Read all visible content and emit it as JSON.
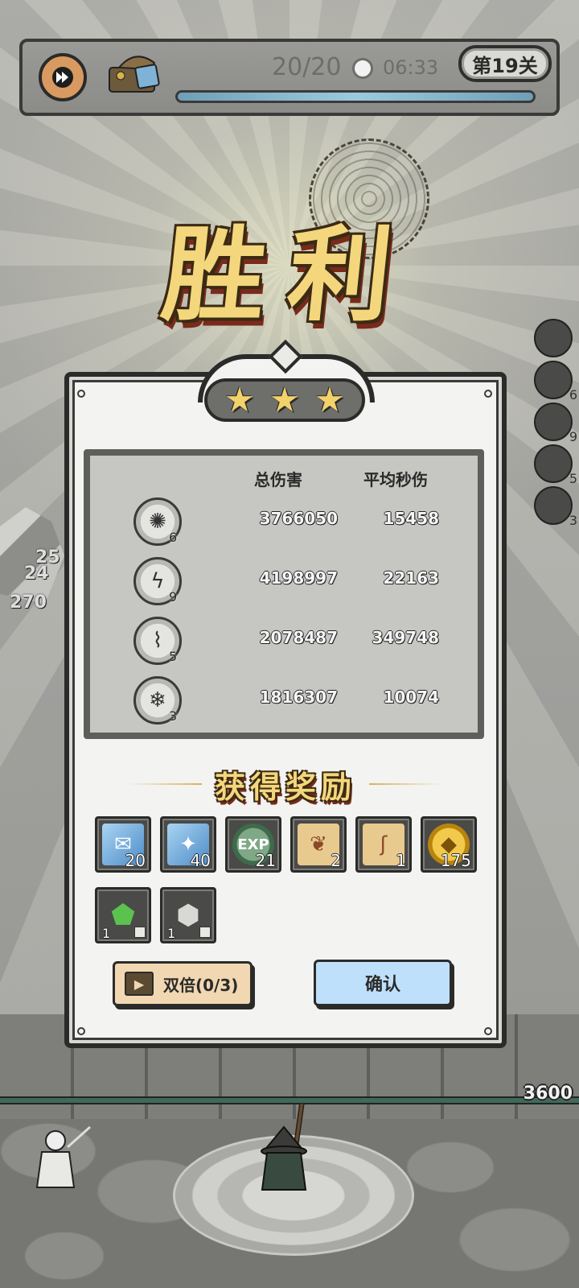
{
  "hud": {
    "wave": "20/20",
    "time": "06:33",
    "level": "第19关",
    "icons": {
      "speed": "fast-forward-icon",
      "chest": "treasure-chest-icon",
      "clock": "clock-icon"
    }
  },
  "victory": {
    "title": "胜利",
    "stars": 3
  },
  "side_heroes": [
    "",
    "6",
    "9",
    "5",
    "3"
  ],
  "battlefield": {
    "base_hp": "3600",
    "floating_damage": [
      "25",
      "24",
      "270"
    ]
  },
  "stats": {
    "headers": {
      "total": "总伤害",
      "avg": "平均秒伤"
    },
    "rows": [
      {
        "icon": "dark-vortex-hero-icon",
        "level": "6",
        "total": "3766050",
        "avg": "15458"
      },
      {
        "icon": "lightning-hero-icon",
        "level": "9",
        "total": "4198997",
        "avg": "22163"
      },
      {
        "icon": "cracked-earth-hero-icon",
        "level": "5",
        "total": "2078487",
        "avg": "349748"
      },
      {
        "icon": "ice-crystal-hero-icon",
        "level": "3",
        "total": "1816307",
        "avg": "10074"
      }
    ]
  },
  "rewards": {
    "title": "获得奖励",
    "items": [
      {
        "icon": "blue-paper-crystal-icon",
        "count": "20",
        "color": "#5f9fd8"
      },
      {
        "icon": "blue-shard-crystal-icon",
        "count": "40",
        "color": "#5f9fd8"
      },
      {
        "icon": "exp-orb-icon",
        "label": "EXP",
        "count": "21",
        "color": "#3e6b4a"
      },
      {
        "icon": "meat-scroll-icon",
        "count": "2",
        "color": "#e8c98e"
      },
      {
        "icon": "hook-scroll-icon",
        "count": "1",
        "color": "#e8c98e"
      },
      {
        "icon": "gold-coin-icon",
        "count": "175",
        "color": "#d8a31e"
      },
      {
        "icon": "green-gem-icon",
        "count": "1",
        "color": "#3c9a3a"
      },
      {
        "icon": "grey-ore-icon",
        "count": "1",
        "color": "#8c8c88"
      }
    ]
  },
  "buttons": {
    "double": "双倍(0/3)",
    "confirm": "确认"
  },
  "colors": {
    "gold_text": "#f4d77c",
    "confirm_bg": "#bfe0fb",
    "double_bg": "#f2d8b2",
    "panel_bg": "#f3f3f1"
  }
}
